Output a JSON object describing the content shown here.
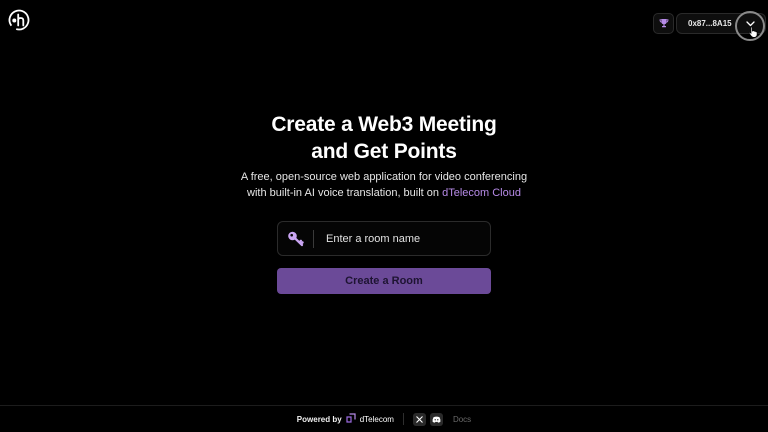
{
  "header": {
    "logo_icon": "dh-logo-icon",
    "trophy_icon": "trophy-icon",
    "wallet_address": "0x87...8A15",
    "wallet_chevron_icon": "chevron-down-icon"
  },
  "hero": {
    "title_line1": "Create a Web3 Meeting",
    "title_line2": "and Get Points",
    "subtitle_line1": "A free, open-source web application for video conferencing",
    "subtitle_line2_prefix": "with built-in AI voice translation, built on ",
    "subtitle_link": "dTelecom Cloud"
  },
  "room_form": {
    "key_icon": "key-icon",
    "input_placeholder": "Enter a room name",
    "input_value": "",
    "create_button_label": "Create a Room"
  },
  "footer": {
    "powered_by": "Powered by",
    "brand": "dTelecom",
    "x_icon": "x-icon",
    "discord_icon": "discord-icon",
    "docs_label": "Docs"
  },
  "colors": {
    "background": "#000000",
    "accent": "#b78be8",
    "button": "#6b4a98",
    "trophy": "#b78be8"
  }
}
